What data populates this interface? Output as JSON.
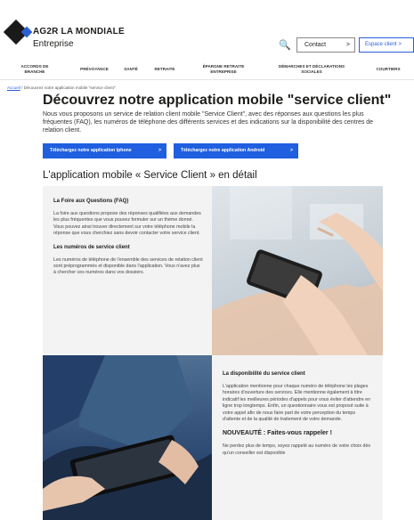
{
  "header": {
    "brand": "AG2R LA MONDIALE",
    "sub_brand": "Entreprise",
    "contact_label": "Contact",
    "espace_label": "Espace client",
    "chevron": ">"
  },
  "nav": {
    "items": [
      "ACCORDS DE BRANCHE",
      "PRÉVOYANCE",
      "SANTÉ",
      "RETRAITE",
      "ÉPARGNE RETRAITE ENTREPRISE",
      "DÉMARCHES ET DÉCLARATIONS SOCIALES",
      "COURTIERS"
    ]
  },
  "breadcrumb": {
    "home": "Accueil",
    "current": "/ Découvrez notre application mobile \"service client\""
  },
  "main": {
    "title": "Découvrez notre application mobile \"service client\"",
    "intro": "Nous vous proposons un service de relation client mobile \"Service Client\", avec des réponses aux questions les plus fréquentes (FAQ), les numéros de téléphone des différents services et des indications sur la disponibilité des centres de relation client.",
    "btn_iphone": "Téléchargez notre application Iphone",
    "btn_android": "Téléchargez notre application Android",
    "section_title": "L'application mobile « Service Client » en détail"
  },
  "section1": {
    "faq_title": "La Foire aux Questions (FAQ)",
    "faq_body": "La foire aux questions propose des réponses qualifiées aux demandes les plus fréquentes que vous pouvez formuler sur un thème donné. Vous pouvez ainsi trouver directement sur votre téléphone mobile la réponse que vous cherchiez sans devoir contacter votre service client.",
    "numbers_title": "Les numéros de service client",
    "numbers_body": "Les numéros de téléphone de l'ensemble des services de relation client sont préprogrammés et disponible dans l'application. Vous n'avez plus à chercher ces numéros dans vos dossiers."
  },
  "section2": {
    "dispo_title": "La disponibilité du service client",
    "dispo_body": "L'application mentionne pour chaque numéro de téléphone les plages horaires d'ouverture des services. Elle mentionne également à titre indicatif les meilleures périodes d'appels pour vous éviter d'attendre en ligne trop longtemps. Enfin, un questionnaire vous est proposé suite à votre appel afin de nous faire part de votre perception du temps d'attente et de la qualité de traitement de votre demande.",
    "new_title": "NOUVEAUTÉ : Faites-vous rappeler !",
    "new_body": "Ne perdez plus de temps, soyez rappelé au numéro de votre choix dès qu'un conseiller est disponible"
  },
  "icons": {
    "search": "🔍"
  },
  "colors": {
    "accent": "#1f5fe0",
    "text": "#1d1d1b",
    "card_bg": "#f3f3f3"
  }
}
